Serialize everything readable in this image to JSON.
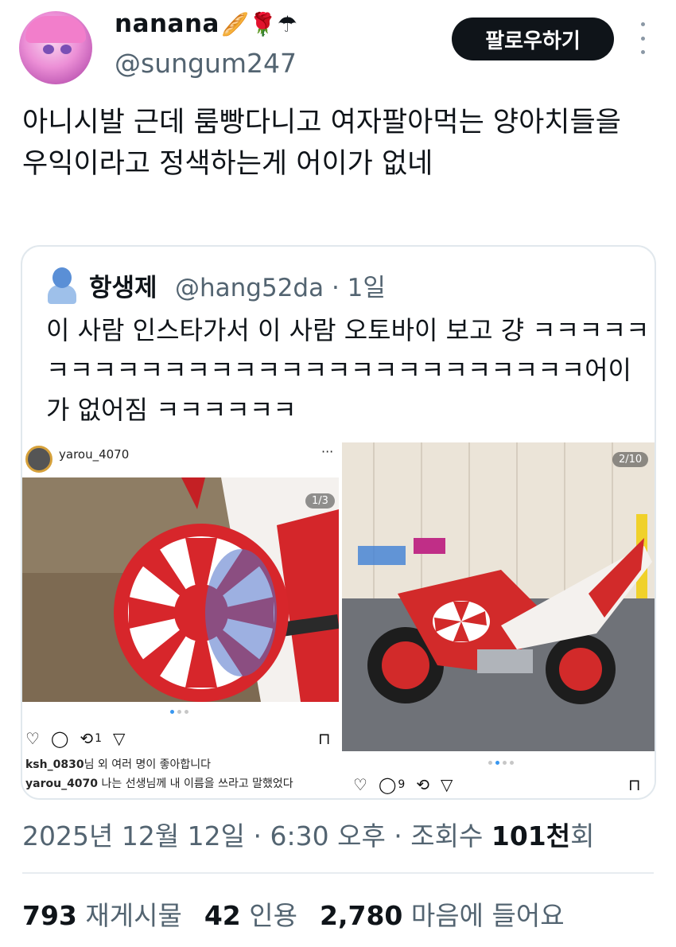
{
  "author": {
    "display_name": "nanana",
    "name_emojis": "🥖🌹☂",
    "handle": "@sungum247",
    "follow_label": "팔로우하기"
  },
  "tweet": {
    "text": "아니시발 근데 룸빵다니고 여자팔아먹는 양아치들을 우익이라고 정색하는게 어이가 없네"
  },
  "quote": {
    "name": "항생제",
    "handle_time": "@hang52da · 1일",
    "text": "이 사람 인스타가서 이 사람 오토바이 보고 걍 ㅋㅋㅋㅋㅋㅋㅋㅋㅋㅋㅋㅋㅋㅋㅋㅋㅋㅋㅋㅋㅋㅋㅋㅋㅋㅋㅋㅋ어이가 없어짐 ㅋㅋㅋㅋㅋㅋ",
    "left_post": {
      "username": "yarou_4070",
      "more": "···",
      "counter": "1/3",
      "repost_count": "1",
      "likes_user": "ksh_0830",
      "likes_rest": "님 외 여러 명이 좋아합니다",
      "caption_user": "yarou_4070",
      "caption_text": " 나는 선생님께 내 이름을 쓰라고 말했었다"
    },
    "right_post": {
      "counter": "2/10",
      "comment_count": "9"
    }
  },
  "meta": {
    "datetime": "2025년 12월 12일 · 6:30 오후 · 조회수 ",
    "views": "101천",
    "views_suffix": "회"
  },
  "stats": {
    "reposts_count": "793",
    "reposts_label": "재게시물",
    "quotes_count": "42",
    "quotes_label": "인용",
    "likes_count": "2,780",
    "likes_label": "마음에 들어요"
  }
}
